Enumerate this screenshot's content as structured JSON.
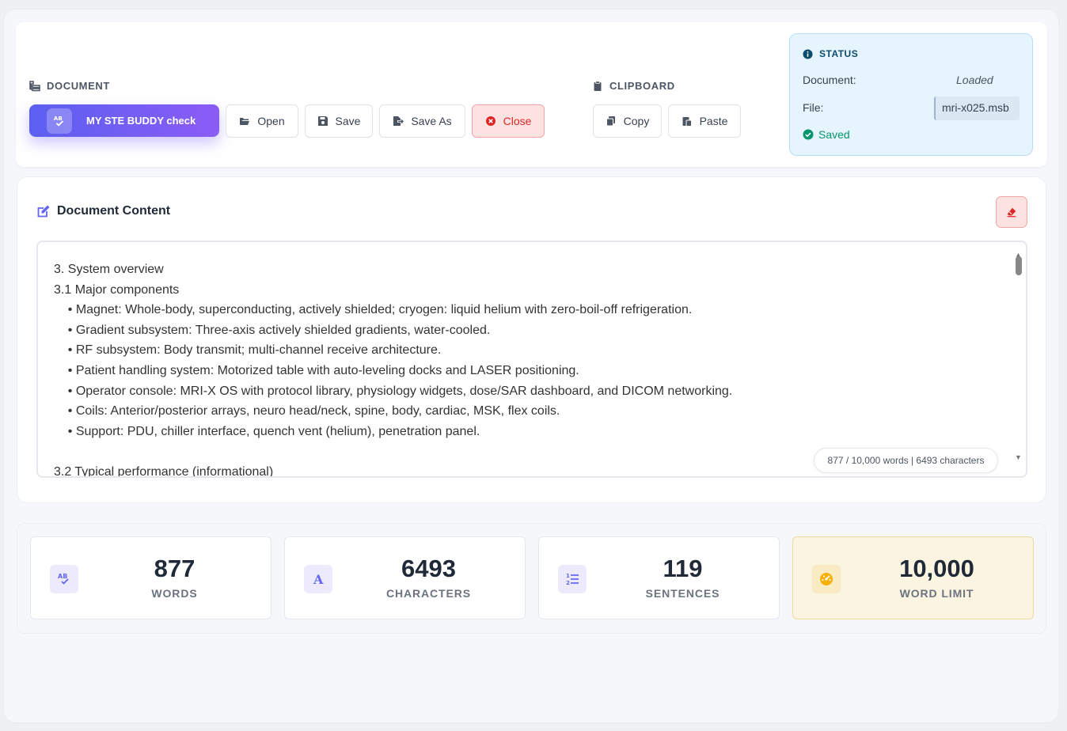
{
  "toolbar": {
    "document_group": "DOCUMENT",
    "primary_label": "MY STE BUDDY check",
    "open_label": "Open",
    "save_label": "Save",
    "save_as_label": "Save As",
    "close_label": "Close",
    "clipboard_group": "CLIPBOARD",
    "copy_label": "Copy",
    "paste_label": "Paste"
  },
  "status": {
    "title": "STATUS",
    "document_label": "Document:",
    "document_value": "Loaded",
    "file_label": "File:",
    "file_value": "mri-x025.msb",
    "saved_label": "Saved"
  },
  "content": {
    "title": "Document Content",
    "lines": [
      "3. System overview",
      "3.1 Major components",
      "    • Magnet: Whole-body, superconducting, actively shielded; cryogen: liquid helium with zero-boil-off refrigeration.",
      "    • Gradient subsystem: Three-axis actively shielded gradients, water-cooled.",
      "    • RF subsystem: Body transmit; multi-channel receive architecture.",
      "    • Patient handling system: Motorized table with auto-leveling docks and LASER positioning.",
      "    • Operator console: MRI-X OS with protocol library, physiology widgets, dose/SAR dashboard, and DICOM networking.",
      "    • Coils: Anterior/posterior arrays, neuro head/neck, spine, body, cardiac, MSK, flex coils.",
      "    • Support: PDU, chiller interface, quench vent (helium), penetration panel.",
      "",
      "3.2 Typical performance (informational)"
    ],
    "counter": "877 / 10,000 words | 6493 characters"
  },
  "stats": {
    "words": {
      "value": "877",
      "label": "WORDS"
    },
    "characters": {
      "value": "6493",
      "label": "CHARACTERS"
    },
    "sentences": {
      "value": "119",
      "label": "SENTENCES"
    },
    "limit": {
      "value": "10,000",
      "label": "WORD LIMIT"
    }
  },
  "colors": {
    "accent_start": "#5b5ff0",
    "accent_end": "#8b5cf6",
    "danger": "#dc2626",
    "success": "#059669",
    "info": "#0c4a6e"
  }
}
